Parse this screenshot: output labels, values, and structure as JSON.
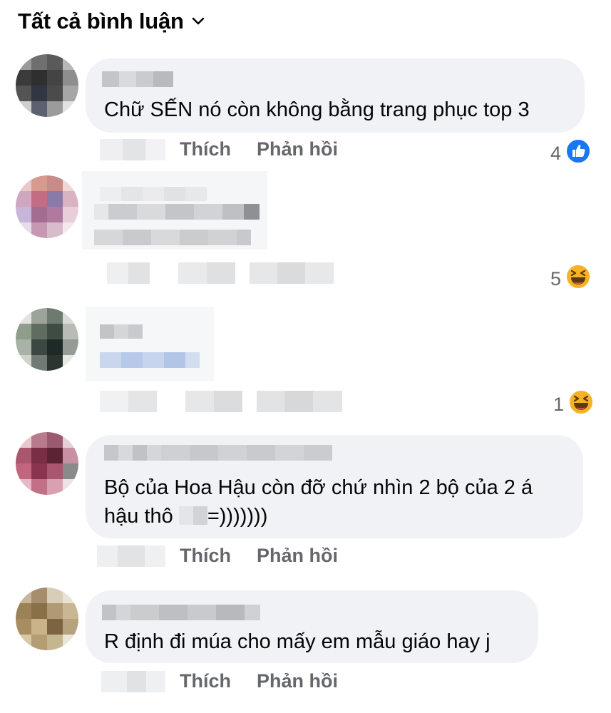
{
  "header": {
    "title": "Tất cả bình luận",
    "dropdown_icon": "chevron-down-icon"
  },
  "actions": {
    "like": "Thích",
    "reply": "Phản hồi"
  },
  "comments": [
    {
      "text": "Chữ SẾN nó còn không bằng trang phục top 3",
      "reaction_count": "4",
      "reaction_icon": "like-icon"
    },
    {
      "reaction_count": "5",
      "reaction_icon": "haha-icon"
    },
    {
      "reaction_count": "1",
      "reaction_icon": "haha-icon"
    },
    {
      "text_line1": "Bộ của Hoa Hậu còn đỡ chứ nhìn 2 bộ của 2 á",
      "text_line2_prefix": "hậu thô ",
      "text_line2_suffix": "=)))))))"
    },
    {
      "text": "R định đi múa cho mấy em mẫu giáo hay j"
    }
  ],
  "colors": {
    "like_blue": "#1877f2",
    "haha_yellow": "#f7b125",
    "bubble_bg": "#f0f2f5",
    "meta_gray": "#65676b"
  }
}
